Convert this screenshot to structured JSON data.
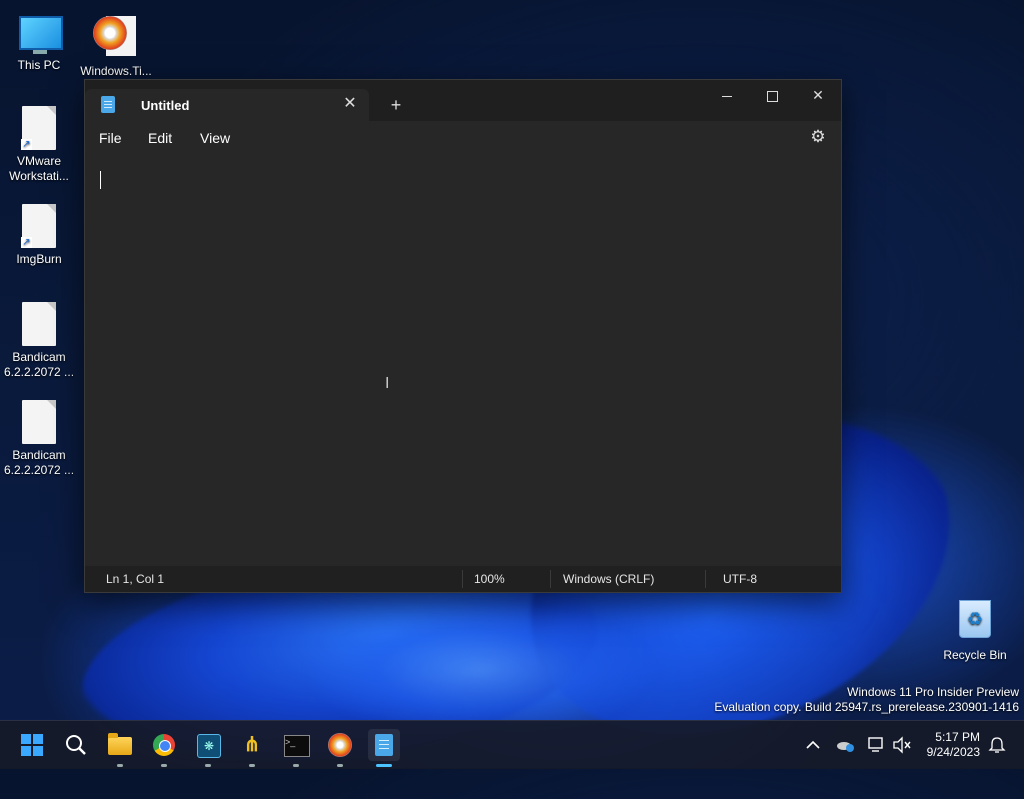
{
  "desktop": {
    "icons": [
      {
        "label": "This PC"
      },
      {
        "label": "Windows.Ti..."
      },
      {
        "label": "VMware Workstati..."
      },
      {
        "label": "ImgBurn"
      },
      {
        "label": "Bandicam 6.2.2.2072 ..."
      },
      {
        "label": "Bandicam 6.2.2.2072 ..."
      },
      {
        "label": "Recycle Bin"
      }
    ],
    "watermark": {
      "line1": "Windows 11 Pro Insider Preview",
      "line2": "Evaluation copy. Build 25947.rs_prerelease.230901-1416"
    }
  },
  "notepad": {
    "tab_title": "Untitled",
    "tab_close": "✕",
    "new_tab": "+",
    "window_controls": {
      "close": "✕"
    },
    "menu": {
      "file": "File",
      "edit": "Edit",
      "view": "View"
    },
    "settings_icon": "⚙",
    "content": "",
    "status": {
      "position": "Ln 1, Col 1",
      "zoom": "100%",
      "line_endings": "Windows (CRLF)",
      "encoding": "UTF-8"
    }
  },
  "taskbar": {
    "icons": [
      "windows-start-icon",
      "search-icon",
      "file-explorer-icon",
      "chrome-icon",
      "vscode-icon",
      "app-icon",
      "terminal-icon",
      "imgburn-icon",
      "notepad-icon"
    ],
    "tray": {
      "chevron": "^"
    },
    "clock": {
      "time": "5:17 PM",
      "date": "9/24/2023"
    },
    "accent": "#4cc2ff"
  }
}
